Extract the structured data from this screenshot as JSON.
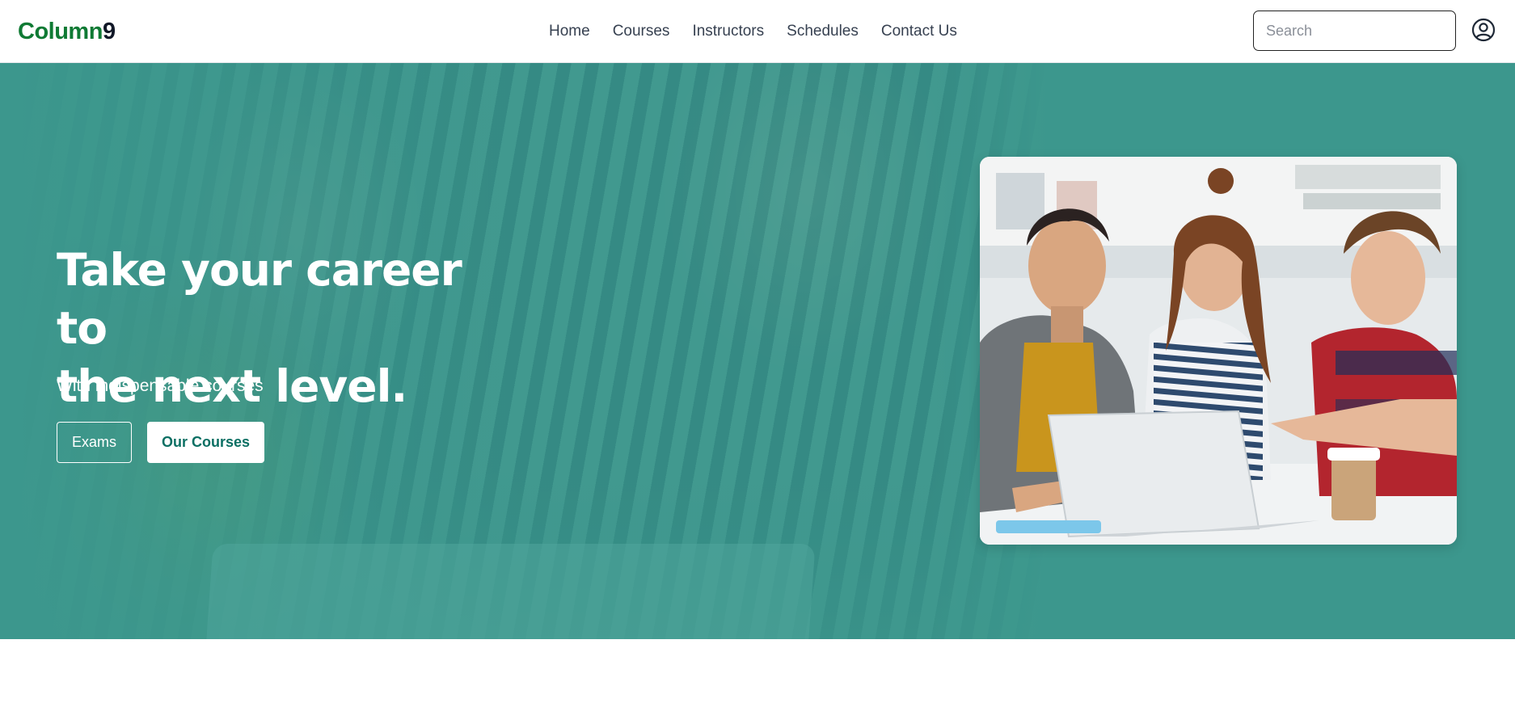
{
  "brand": {
    "word": "Column",
    "number": "9"
  },
  "nav": {
    "items": [
      {
        "label": "Home"
      },
      {
        "label": "Courses"
      },
      {
        "label": "Instructors"
      },
      {
        "label": "Schedules"
      },
      {
        "label": "Contact Us"
      }
    ]
  },
  "search": {
    "placeholder": "Search",
    "value": ""
  },
  "header_icons": {
    "user": "user-circle-icon"
  },
  "hero": {
    "title_line1": "Take your career to",
    "title_line2": "the next level.",
    "subtitle": "With indispensable courses",
    "buttons": {
      "exams": "Exams",
      "our_courses": "Our Courses"
    }
  },
  "colors": {
    "brand_green": "#0f7a34",
    "hero_teal": "#4f9e95",
    "button_text_teal": "#0b6f63"
  }
}
